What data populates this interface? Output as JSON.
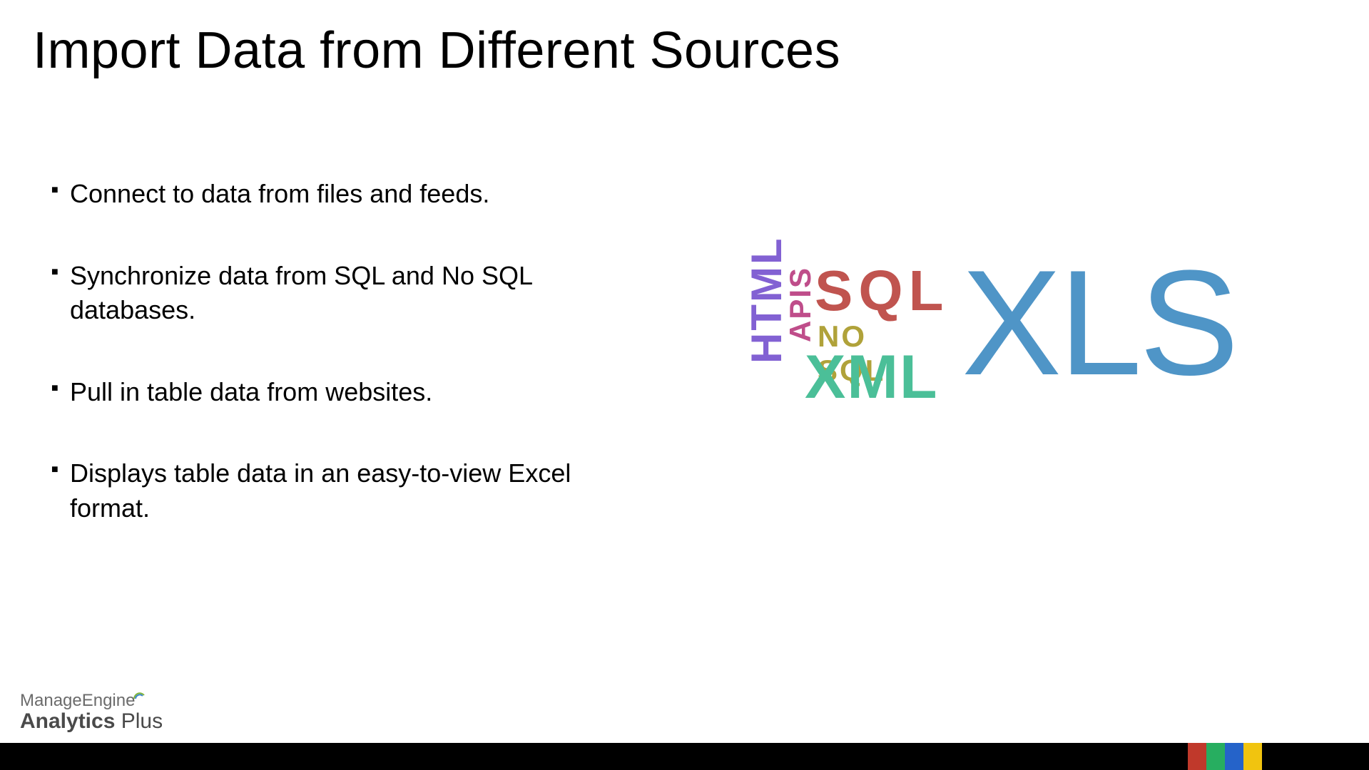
{
  "title": "Import Data from Different Sources",
  "bullets": [
    "Connect to data from files and feeds.",
    "Synchronize data from SQL and No SQL databases.",
    "Pull in table data from websites.",
    "Displays table data in an easy-to-view Excel format."
  ],
  "wordcloud": {
    "html": "HTML",
    "apis": "APIS",
    "sql": "SQL",
    "nosql": "NO SQL",
    "xml": "XML",
    "xls": "XLS"
  },
  "logo": {
    "line1": "ManageEngine",
    "line2_bold": "Analytics",
    "line2_rest": " Plus"
  },
  "footer_colors": [
    "#c0392b",
    "#27ae60",
    "#2563c9",
    "#f1c40f"
  ]
}
